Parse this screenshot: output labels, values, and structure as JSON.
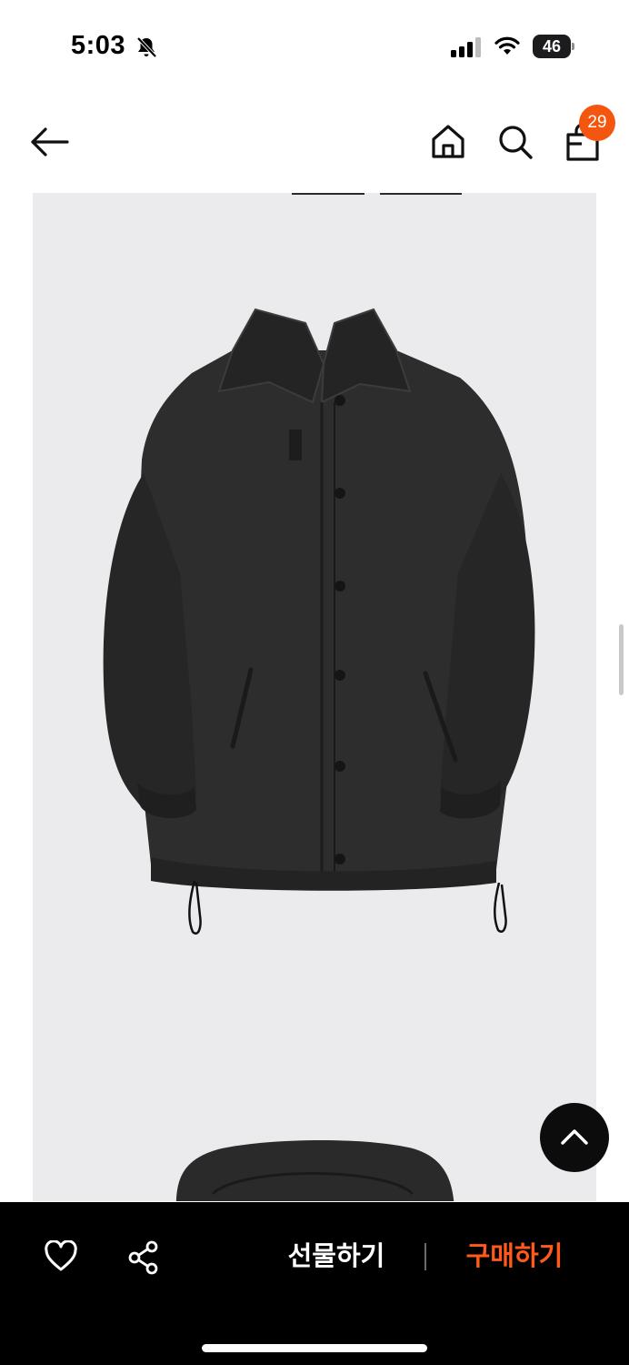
{
  "status_bar": {
    "time": "5:03",
    "battery": "46",
    "icons": [
      "bell-slash-icon",
      "cellular-signal-icon",
      "wifi-icon",
      "battery-icon"
    ]
  },
  "header": {
    "icons": [
      "back-arrow-icon",
      "home-icon",
      "search-icon",
      "shopping-bag-icon"
    ],
    "cart_count": "29",
    "badge_color": "#f5560f"
  },
  "product": {
    "image_background": "#ebebed",
    "main_image": "black-padded-coach-jacket",
    "next_image": "black-padded-jacket-partial"
  },
  "scroll_top_button": {
    "icon": "chevron-up-icon"
  },
  "bottom_bar": {
    "like_icon": "heart-icon",
    "share_icon": "share-icon",
    "gift_label": "선물하기",
    "buy_label": "구매하기",
    "buy_color": "#ff5a1a"
  }
}
